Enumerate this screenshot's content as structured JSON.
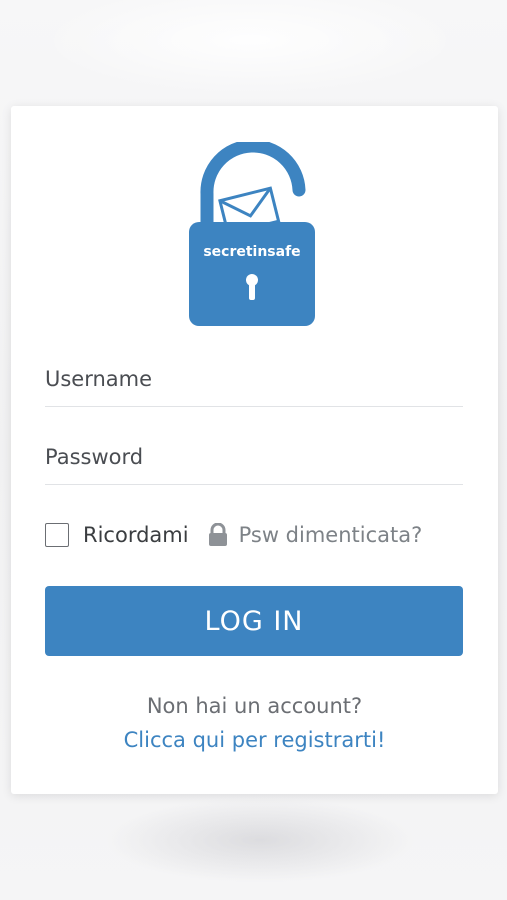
{
  "logo": {
    "brand_text": "secretinsafe",
    "icon": "padlock-with-envelope-icon",
    "color": "#3d84c1"
  },
  "form": {
    "username_placeholder": "Username",
    "password_placeholder": "Password",
    "remember_label": "Ricordami",
    "remember_checked": false,
    "forgot_icon": "lock-icon",
    "forgot_label": "Psw dimenticata?",
    "login_label": "LOG IN"
  },
  "footer": {
    "no_account_text": "Non hai un account?",
    "register_link": "Clicca qui per registrarti!"
  },
  "colors": {
    "accent": "#3d84c1",
    "text": "#3a3d40",
    "muted": "#7d8287"
  }
}
